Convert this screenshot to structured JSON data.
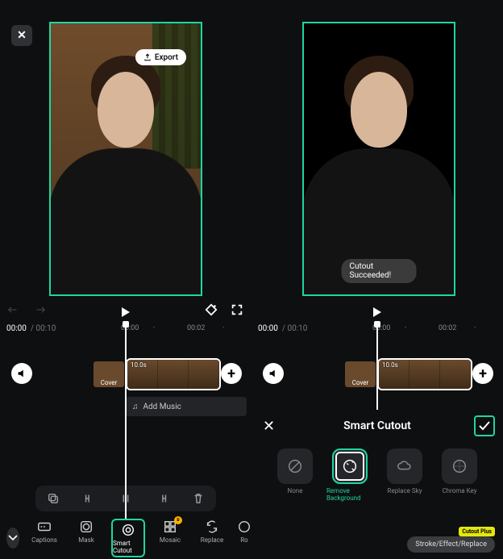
{
  "left": {
    "export_label": "Export",
    "time_current": "00:00",
    "time_total": "00:10",
    "ruler": [
      "00:00",
      "00:02"
    ],
    "clip_duration": "10.0s",
    "cover_label": "Cover",
    "add_music": "Add Music",
    "tools": [
      {
        "id": "captions",
        "label": "Captions"
      },
      {
        "id": "mask",
        "label": "Mask"
      },
      {
        "id": "smart-cutout",
        "label": "Smart Cutout"
      },
      {
        "id": "mosaic",
        "label": "Mosaic"
      },
      {
        "id": "replace",
        "label": "Replace"
      },
      {
        "id": "more",
        "label": "Ro"
      }
    ]
  },
  "right": {
    "toast": "Cutout Succeeded!",
    "time_current": "00:00",
    "time_total": "00:10",
    "ruler": [
      "00:00",
      "00:02"
    ],
    "clip_duration": "10.0s",
    "cover_label": "Cover",
    "sheet_title": "Smart Cutout",
    "options": [
      {
        "id": "none",
        "label": "None"
      },
      {
        "id": "remove-bg",
        "label": "Remove Background"
      },
      {
        "id": "replace-sky",
        "label": "Replace Sky"
      },
      {
        "id": "chroma-key",
        "label": "Chroma Key"
      }
    ],
    "stroke_pill": "Stroke/Effect/Replace",
    "cutout_plus": "Cutout Plus"
  }
}
